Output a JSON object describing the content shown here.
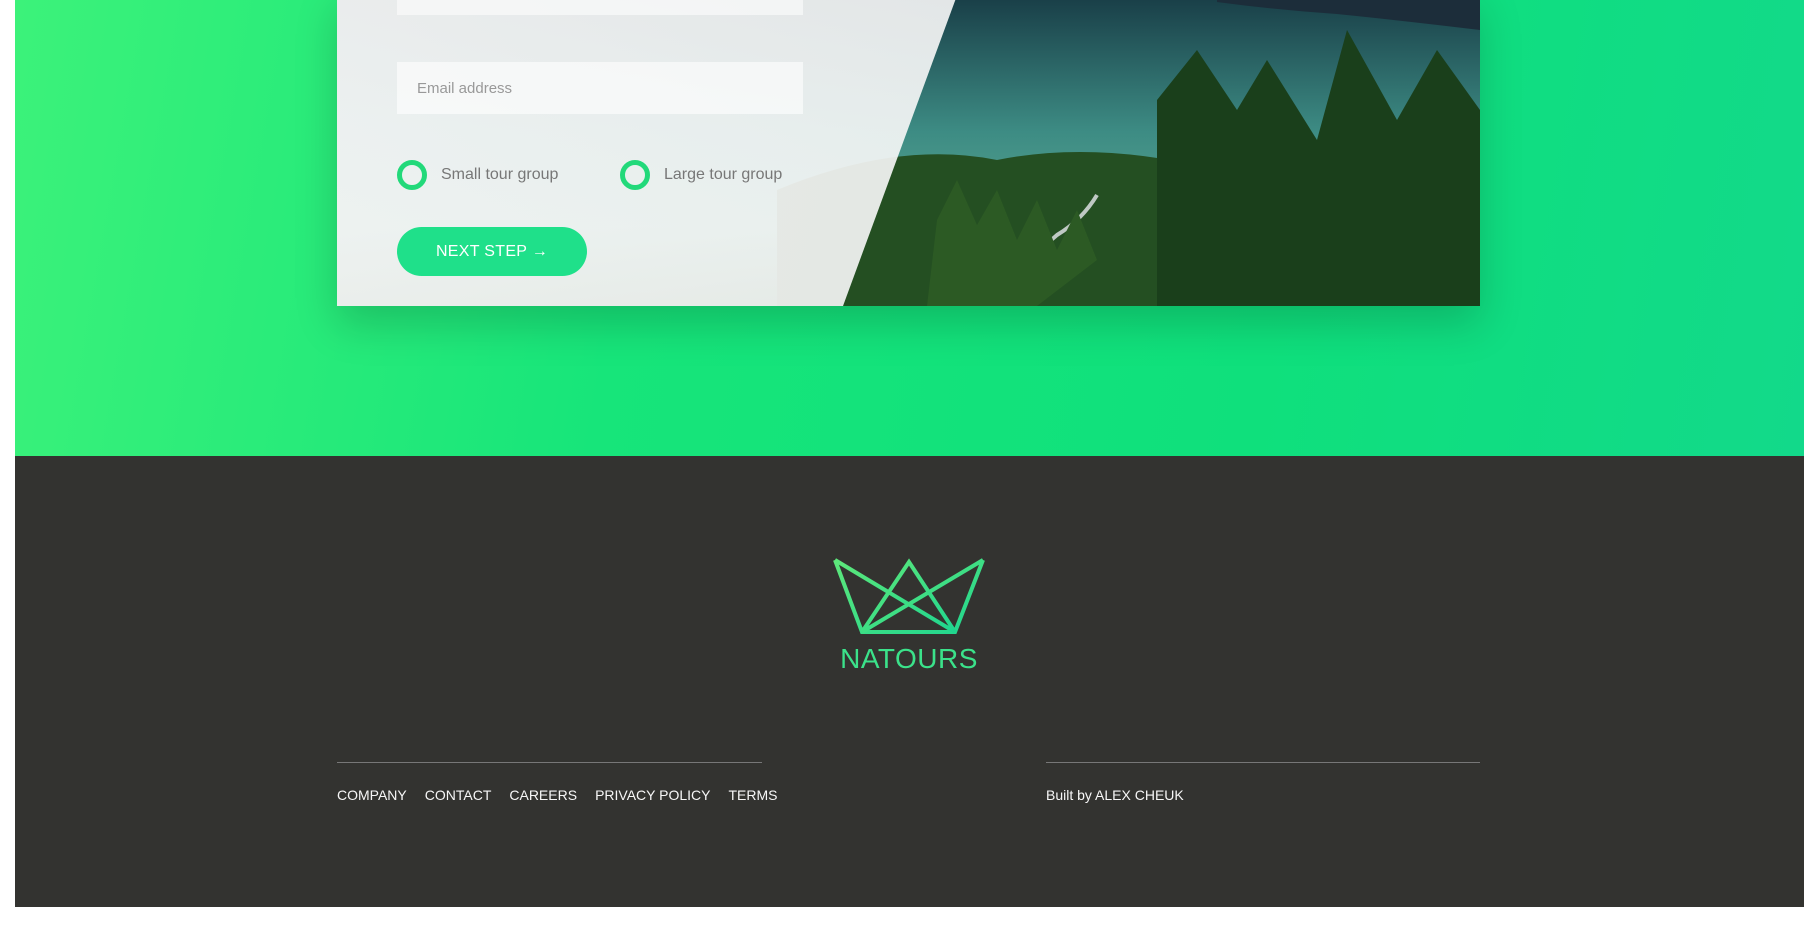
{
  "form": {
    "email_placeholder": "Email address",
    "radios": [
      {
        "label": "Small tour group"
      },
      {
        "label": "Large tour group"
      }
    ],
    "next_button": "NEXT STEP →"
  },
  "footer": {
    "brand": "NATOURS",
    "nav": [
      "COMPANY",
      "CONTACT",
      "CAREERS",
      "PRIVACY POLICY",
      "TERMS"
    ],
    "credit": "Built by ALEX CHEUK"
  },
  "colors": {
    "accent_green": "#1fe08a",
    "footer_bg": "#333330",
    "brand_green": "#3be28a"
  }
}
